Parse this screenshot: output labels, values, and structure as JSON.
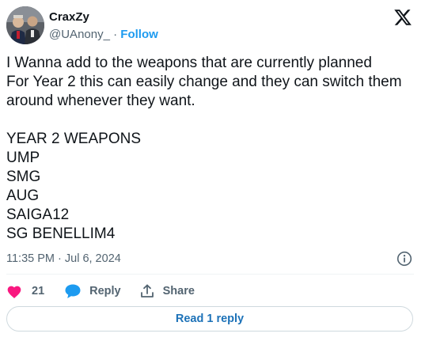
{
  "author": {
    "display_name": "CraxZy",
    "handle": "@UAnony_",
    "separator": "·",
    "follow_label": "Follow"
  },
  "tweet": {
    "lines": [
      "I Wanna add to the weapons that are currently planned",
      "For Year 2 this can easily change and they can switch them",
      "around whenever they want.",
      "",
      "YEAR 2 WEAPONS",
      "UMP",
      "SMG",
      "AUG",
      "SAIGA12",
      "SG BENELLIM4"
    ],
    "timestamp": "11:35 PM · Jul 6, 2024"
  },
  "actions": {
    "like_count": "21",
    "reply_label": "Reply",
    "share_label": "Share"
  },
  "read_replies_label": "Read 1 reply",
  "icons": {
    "brand": "x-logo-icon",
    "info": "info-icon",
    "like": "heart-icon",
    "reply": "speech-bubble-icon",
    "share": "share-upload-icon"
  },
  "colors": {
    "like": "#f91880",
    "reply": "#1d9bf0",
    "follow": "#1d9bf0",
    "read_replies": "#1d72b8",
    "secondary_text": "#536471"
  }
}
